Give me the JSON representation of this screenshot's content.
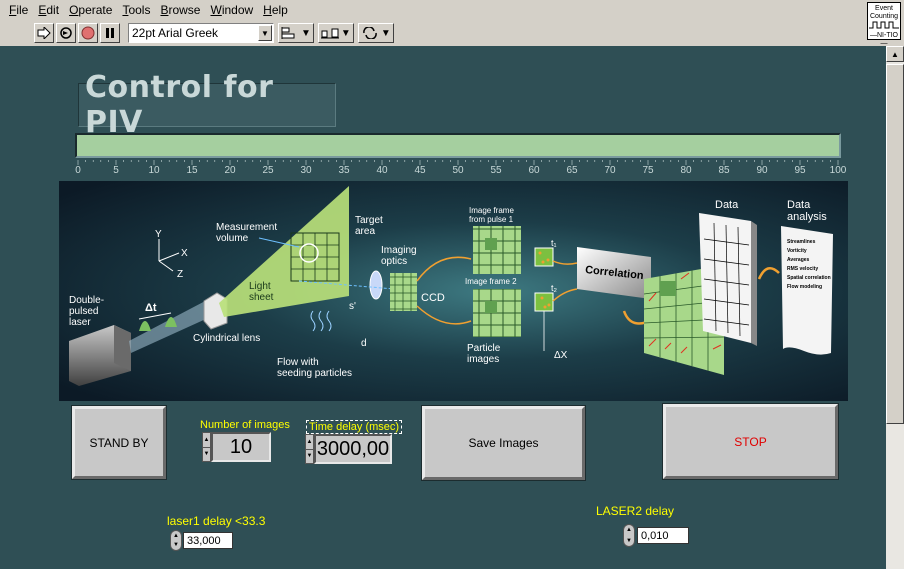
{
  "menu": [
    "File",
    "Edit",
    "Operate",
    "Tools",
    "Browse",
    "Window",
    "Help"
  ],
  "toolbar": {
    "font": "22pt Arial Greek",
    "run_icon": "run-arrow-icon",
    "continuous_icon": "run-continuous-icon",
    "abort_icon": "abort-icon",
    "pause_icon": "pause-icon"
  },
  "vi_icon": {
    "line1": "Event",
    "line2": "Counting",
    "line3": "—NI-TIO—"
  },
  "title": "Control for PIV",
  "progress": {
    "value": 100,
    "min": 0,
    "max": 100,
    "ticks": [
      "0",
      "5",
      "10",
      "15",
      "20",
      "25",
      "30",
      "35",
      "40",
      "45",
      "50",
      "55",
      "60",
      "65",
      "70",
      "75",
      "80",
      "85",
      "90",
      "95",
      "100"
    ],
    "fill_color": "#a5cf9f"
  },
  "diagram": {
    "double_pulsed_laser": [
      "Double-",
      "pulsed",
      "laser"
    ],
    "delta_t": "Δt",
    "axes": {
      "y": "Y",
      "x": "X",
      "z": "Z"
    },
    "cylindrical_lens": "Cylindrical lens",
    "measurement_volume": [
      "Measurement",
      "volume"
    ],
    "light_sheet": [
      "Light",
      "sheet"
    ],
    "target_area": [
      "Target",
      "area"
    ],
    "imaging_optics": [
      "Imaging",
      "optics"
    ],
    "ccd": "CCD",
    "s_prime": "s'",
    "d": "d",
    "flow": [
      "Flow with",
      "seeding particles"
    ],
    "frame1": [
      "Image frame",
      "from pulse 1"
    ],
    "frame2": "Image frame 2",
    "t1": "t₁",
    "t2": "t₂",
    "particle_images": [
      "Particle",
      "images"
    ],
    "delta_x": "ΔX",
    "correlation": "Correlation",
    "data": "Data",
    "data_analysis": [
      "Data",
      "analysis"
    ],
    "analysis_lines": [
      "Streamlines",
      "Vorticity",
      "Averages",
      "RMS velocity",
      "Spatial correlation",
      "Flow modeling"
    ]
  },
  "controls": {
    "standby_label": "STAND BY",
    "save_label": "Save Images",
    "stop_label": "STOP",
    "num_images_label": "Number of images",
    "num_images_value": "10",
    "time_delay_label": "Time delay (msec)",
    "time_delay_value": "3000,00",
    "laser1_label": "laser1 delay <33.3",
    "laser1_value": "33,000",
    "laser2_label": "LASER2 delay",
    "laser2_value": "0,010"
  },
  "colors": {
    "panel": "#2f4f55",
    "label_yellow": "#ffff00",
    "stop_red": "#e00000",
    "grid_green": "#a8d88a"
  }
}
